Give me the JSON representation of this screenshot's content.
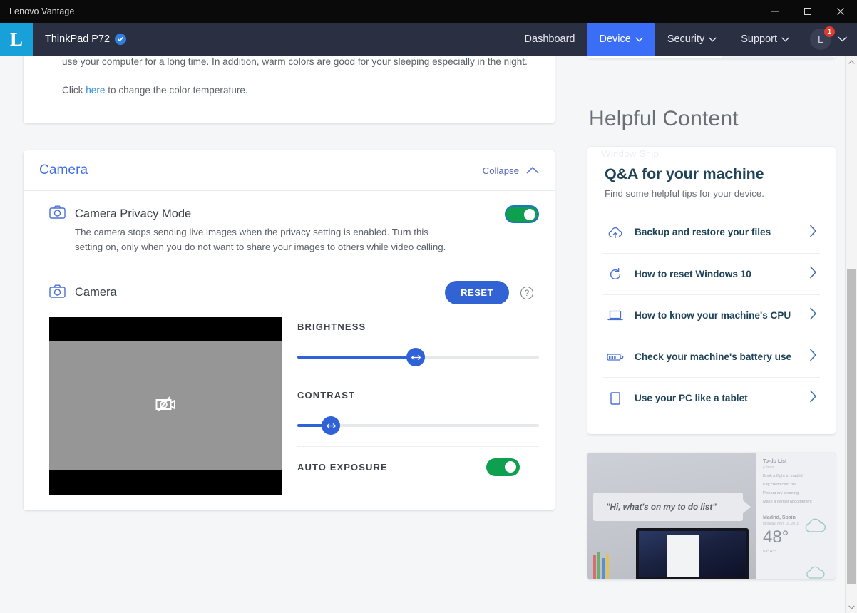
{
  "window": {
    "title": "Lenovo Vantage",
    "controls": {
      "minimize": "minimize-icon",
      "maximize": "maximize-icon",
      "close": "close-icon"
    }
  },
  "appbar": {
    "logo_letter": "L",
    "device_name": "ThinkPad P72",
    "verified_icon": "verified-check-icon",
    "nav": [
      {
        "label": "Dashboard",
        "has_chevron": false,
        "active": false
      },
      {
        "label": "Device",
        "has_chevron": true,
        "active": true
      },
      {
        "label": "Security",
        "has_chevron": true,
        "active": false
      },
      {
        "label": "Support",
        "has_chevron": true,
        "active": false
      }
    ],
    "profile": {
      "initial": "L",
      "badge_count": "1"
    },
    "accent_active": "#3b6ef6",
    "logo_bg": "#18a0d8",
    "bar_bg": "#2b2f42"
  },
  "display_card": {
    "paragraph": "To avoid eye strain, you can adjust the color temperature of your display to filter out the blue light when you use your computer for a long time. In addition, warm colors are good for your sleeping especially in the night.",
    "click_prefix": "Click",
    "link_text": "here",
    "click_suffix": "to change the color temperature."
  },
  "camera_card": {
    "title": "Camera",
    "collapse_label": "Collapse",
    "collapse_icon": "chevron-up-icon",
    "privacy": {
      "icon": "camera-icon",
      "title": "Camera Privacy Mode",
      "description": "The camera stops sending live images when the privacy setting is enabled. Turn this setting on, only when you do not want to share your images to others while video calling.",
      "toggle_on": true,
      "toggle_color": "#0e9f4f"
    },
    "camera_controls": {
      "icon": "camera-icon",
      "title": "Camera",
      "reset_label": "RESET",
      "reset_color": "#3163d4",
      "help_icon": "question-mark-icon",
      "preview_icon": "camera-disabled-icon",
      "brightness": {
        "label": "BRIGHTNESS",
        "percent": 49
      },
      "contrast": {
        "label": "CONTRAST",
        "percent": 14
      },
      "auto_exposure": {
        "label": "AUTO EXPOSURE",
        "toggle_on": true
      }
    }
  },
  "helpful": {
    "section_title": "Helpful Content",
    "watermark": "Window Snip",
    "qa": {
      "heading": "Q&A for your machine",
      "subheading": "Find some helpful tips for your device.",
      "items": [
        {
          "icon": "cloud-upload-icon",
          "label": "Backup and restore your files",
          "arrow": "chevron-right-icon"
        },
        {
          "icon": "refresh-icon",
          "label": "How to reset Windows 10",
          "arrow": "chevron-right-icon"
        },
        {
          "icon": "laptop-icon",
          "label": "How to know your machine's CPU",
          "arrow": "chevron-right-icon"
        },
        {
          "icon": "battery-icon",
          "label": "Check your machine's battery use",
          "arrow": "chevron-right-icon"
        },
        {
          "icon": "tablet-icon",
          "label": "Use your PC like a tablet",
          "arrow": "chevron-right-icon"
        }
      ]
    },
    "promo": {
      "quote": "\"Hi, what's on my to do list\"",
      "panel_title": "To-do List",
      "panel_subtitle": "4 items",
      "panel_items": [
        "Book a flight to madrid",
        "Pay credit card bill",
        "Pick up dry cleaning",
        "Make a dentist appointment"
      ],
      "location": "Madrid, Spain",
      "date": "Monday, April 16, 2018",
      "temperature": "48°",
      "hi_low": "53° 43°",
      "cloud_icon": "cloud-icon"
    }
  },
  "scrollbar": {
    "up_arrow": "chevron-up-icon",
    "down_arrow": "chevron-down-icon"
  }
}
